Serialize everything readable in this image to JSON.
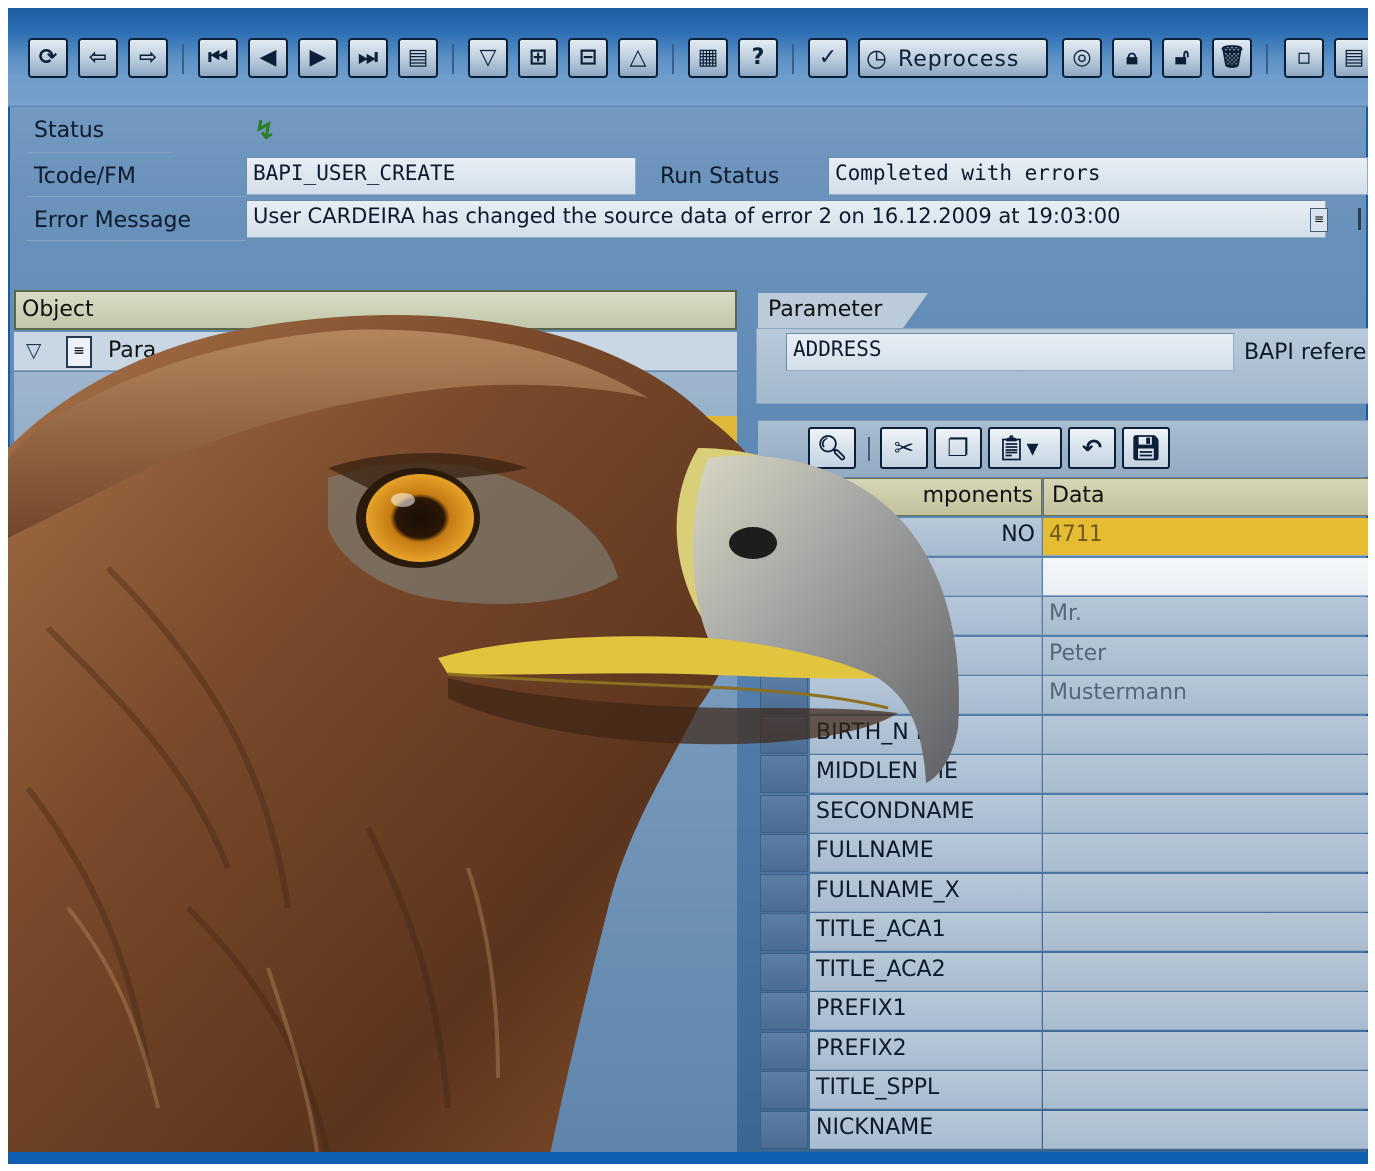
{
  "toolbar": {
    "buttons": [
      {
        "icon": "refresh-icon"
      },
      {
        "icon": "back-doc-icon"
      },
      {
        "icon": "forward-doc-icon"
      },
      {
        "icon": "first-page-icon"
      },
      {
        "icon": "previous-page-icon"
      },
      {
        "icon": "next-page-icon"
      },
      {
        "icon": "last-page-icon"
      },
      {
        "icon": "export-icon"
      },
      {
        "icon": "expand-icon"
      },
      {
        "icon": "expand-all-icon"
      },
      {
        "icon": "collapse-all-icon"
      },
      {
        "icon": "collapse-icon"
      },
      {
        "icon": "document-list-icon"
      },
      {
        "icon": "help-icon"
      },
      {
        "icon": "check-icon"
      }
    ],
    "reprocess_label": "Reprocess",
    "right_buttons": [
      {
        "icon": "target-icon"
      },
      {
        "icon": "lock-icon"
      },
      {
        "icon": "unlock-icon"
      },
      {
        "icon": "delete-icon"
      },
      {
        "icon": "window-icon"
      },
      {
        "icon": "page-icon"
      }
    ]
  },
  "header": {
    "status_label": "Status",
    "tcode_label": "Tcode/FM",
    "tcode_value": "BAPI_USER_CREATE",
    "run_status_label": "Run Status",
    "run_status_value": "Completed with errors",
    "error_label": "Error Message",
    "error_value": "User CARDEIRA has changed the source data of error 2 on 16.12.2009 at 19:03:00"
  },
  "object_panel": {
    "header": "Object",
    "tree_item": "Para"
  },
  "parameter": {
    "tab_label": "Parameter",
    "value": "ADDRESS",
    "bapi_ref_label": "BAPI refere"
  },
  "grid": {
    "col_components": "mponents",
    "col_data": "Data",
    "rows": [
      {
        "component": "NO",
        "data": "4711"
      },
      {
        "component": "",
        "data": ""
      },
      {
        "component": "",
        "data": "Mr."
      },
      {
        "component": "",
        "data": "Peter"
      },
      {
        "component": "",
        "data": "Mustermann"
      },
      {
        "component": "BIRTH_N  E",
        "data": ""
      },
      {
        "component": "MIDDLEN  ME",
        "data": ""
      },
      {
        "component": "SECONDNAME",
        "data": ""
      },
      {
        "component": "FULLNAME",
        "data": ""
      },
      {
        "component": "FULLNAME_X",
        "data": ""
      },
      {
        "component": "TITLE_ACA1",
        "data": ""
      },
      {
        "component": "TITLE_ACA2",
        "data": ""
      },
      {
        "component": "PREFIX1",
        "data": ""
      },
      {
        "component": "PREFIX2",
        "data": ""
      },
      {
        "component": "TITLE_SPPL",
        "data": ""
      },
      {
        "component": "NICKNAME",
        "data": ""
      }
    ]
  },
  "colors": {
    "toolbar_blue": "#2c6fb4",
    "highlight_yellow": "#e6bd32",
    "frame_blue": "#1a5aa8"
  }
}
